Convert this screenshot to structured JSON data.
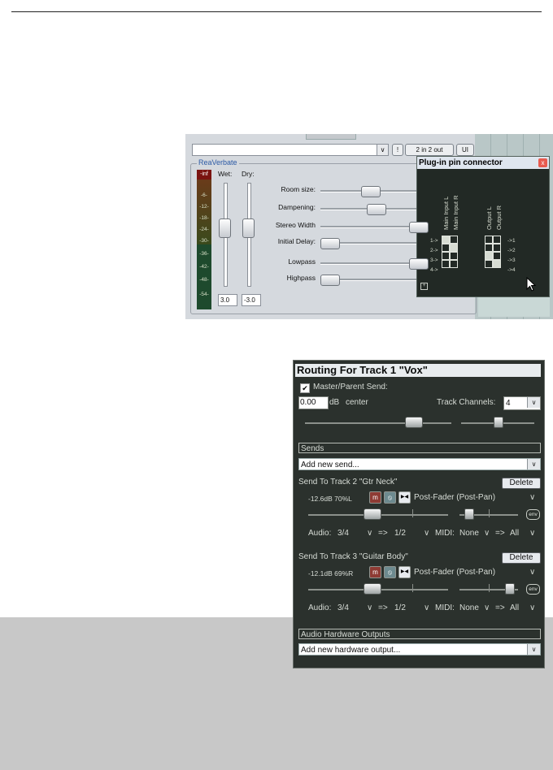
{
  "reaverbate": {
    "combo_btn": "∨",
    "io_small_btn": "!",
    "io_button": "2 in 2 out",
    "ui_button": "UI",
    "plugin_title": "ReaVerbate",
    "meter_top": "-inf",
    "meter_ticks": [
      "-6-",
      "-12-",
      "-18-",
      "-24-",
      "-30-",
      "-36-",
      "-42-",
      "-48-",
      "-54-"
    ],
    "wet_label": "Wet:",
    "dry_label": "Dry:",
    "wet_value": "3.0",
    "dry_value": "-3.0",
    "params": [
      {
        "label": "Room size:",
        "pos": 0.42
      },
      {
        "label": "Dampening:",
        "pos": 0.48
      },
      {
        "label": "Stereo Width",
        "pos": 0.92
      },
      {
        "label": "Initial Delay:",
        "pos": 0.0
      },
      {
        "label": "Lowpass",
        "pos": 0.92
      },
      {
        "label": "Highpass",
        "pos": 0.0
      }
    ],
    "pin_connector": {
      "title": "Plug-in pin connector",
      "close": "x",
      "input_labels": [
        "Main Input L",
        "Main Input R"
      ],
      "output_labels": [
        "Output L",
        "Output R"
      ],
      "in_rows": [
        "1->",
        "2->",
        "3->",
        "4->"
      ],
      "out_rows": [
        "->1",
        "->2",
        "->3",
        "->4"
      ],
      "minus": "−",
      "plus": "+"
    }
  },
  "routing": {
    "title": "Routing For Track 1 \"Vox\"",
    "master_check": "✔",
    "master_send_label": "Master/Parent Send:",
    "volume": "0.00",
    "db_label": "dB",
    "pan_label": "center",
    "track_channels_label": "Track Channels:",
    "track_channels": "4",
    "dropdown_arrow": "∨",
    "sends_header": "Sends",
    "add_send": "Add new send...",
    "sends": [
      {
        "title": "Send To Track 2 \"Gtr Neck\"",
        "delete": "Delete",
        "level": "-12.6dB 70%L",
        "mono": "m",
        "mute": "⦸",
        "phase": "▶◀",
        "mode": "Post-Fader (Post-Pan)",
        "env": "env",
        "audio_label": "Audio:",
        "audio_src": "3/4",
        "arrow": "=>",
        "audio_dst": "1/2",
        "midi_label": "MIDI:",
        "midi_src": "None",
        "midi_dst": "All",
        "fader": 0.42,
        "pan": 0.15
      },
      {
        "title": "Send To Track 3 \"Guitar Body\"",
        "delete": "Delete",
        "level": "-12.1dB 69%R",
        "mono": "m",
        "mute": "⦸",
        "phase": "▶◀",
        "mode": "Post-Fader (Post-Pan)",
        "env": "env",
        "audio_label": "Audio:",
        "audio_src": "3/4",
        "arrow": "=>",
        "audio_dst": "1/2",
        "midi_label": "MIDI:",
        "midi_src": "None",
        "midi_dst": "All",
        "fader": 0.42,
        "pan": 0.85
      }
    ],
    "hw_header": "Audio Hardware Outputs",
    "add_hw": "Add new hardware output..."
  }
}
